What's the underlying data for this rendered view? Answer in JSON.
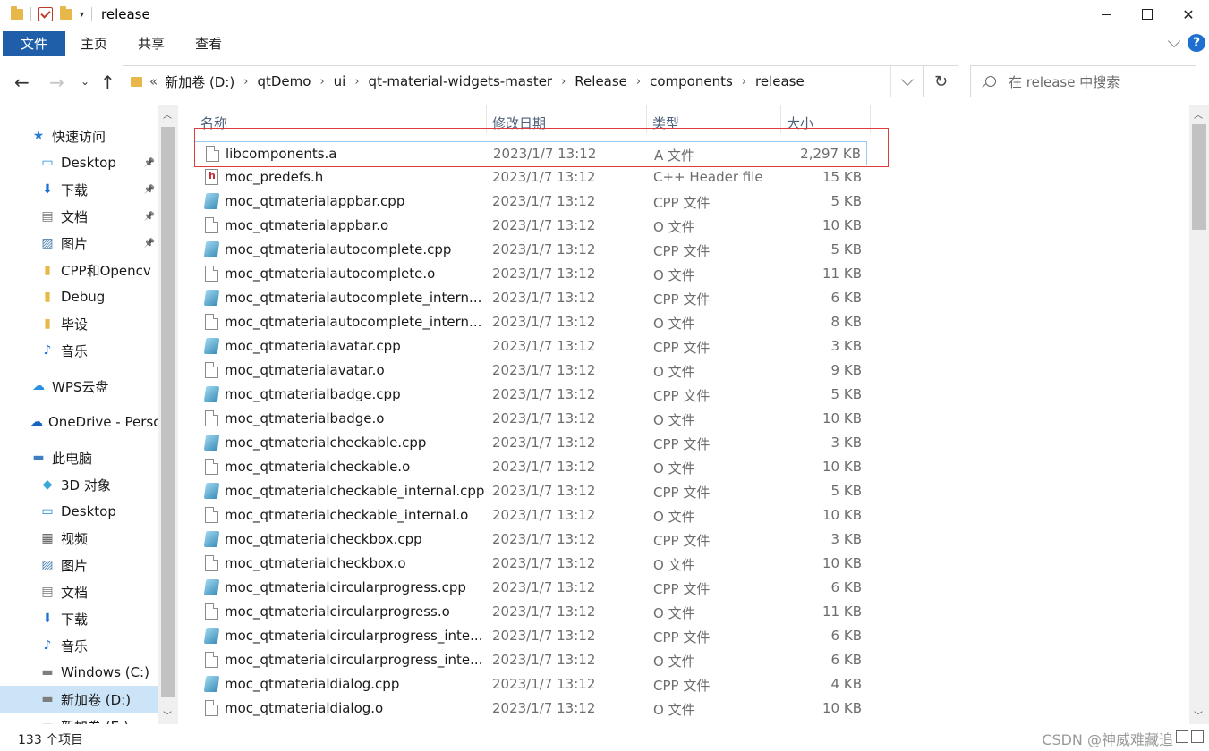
{
  "window": {
    "title": "release",
    "controls": {
      "minimize": "minimize",
      "maximize": "maximize",
      "close": "✕"
    }
  },
  "ribbon": {
    "tabs": [
      "文件",
      "主页",
      "共享",
      "查看"
    ],
    "help": "?"
  },
  "address": {
    "crumbs": [
      "新加卷 (D:)",
      "qtDemo",
      "ui",
      "qt-material-widgets-master",
      "Release",
      "components",
      "release"
    ],
    "overflow": "«",
    "search_placeholder": "在 release 中搜索"
  },
  "sidebar": {
    "items": [
      {
        "label": "快速访问",
        "icon": "star-icon",
        "level": 0,
        "pinned": false
      },
      {
        "label": "Desktop",
        "icon": "desktop-icon",
        "level": 1,
        "pinned": true
      },
      {
        "label": "下载",
        "icon": "download-icon",
        "level": 1,
        "pinned": true
      },
      {
        "label": "文档",
        "icon": "document-icon",
        "level": 1,
        "pinned": true
      },
      {
        "label": "图片",
        "icon": "picture-icon",
        "level": 1,
        "pinned": true
      },
      {
        "label": "CPP和Opencv",
        "icon": "folder-icon",
        "level": 1,
        "pinned": false
      },
      {
        "label": "Debug",
        "icon": "folder-icon",
        "level": 1,
        "pinned": false
      },
      {
        "label": "毕设",
        "icon": "folder-icon",
        "level": 1,
        "pinned": false
      },
      {
        "label": "音乐",
        "icon": "music-icon",
        "level": 1,
        "pinned": false
      },
      {
        "label": "WPS云盘",
        "icon": "cloud-icon",
        "level": 0,
        "pinned": false
      },
      {
        "label": "OneDrive - Perso",
        "icon": "onedrive-icon",
        "level": 0,
        "pinned": false
      },
      {
        "label": "此电脑",
        "icon": "computer-icon",
        "level": 0,
        "pinned": false
      },
      {
        "label": "3D 对象",
        "icon": "cube-icon",
        "level": 1,
        "pinned": false
      },
      {
        "label": "Desktop",
        "icon": "desktop-icon",
        "level": 1,
        "pinned": false
      },
      {
        "label": "视频",
        "icon": "video-icon",
        "level": 1,
        "pinned": false
      },
      {
        "label": "图片",
        "icon": "picture-icon",
        "level": 1,
        "pinned": false
      },
      {
        "label": "文档",
        "icon": "document-icon",
        "level": 1,
        "pinned": false
      },
      {
        "label": "下载",
        "icon": "download-icon",
        "level": 1,
        "pinned": false
      },
      {
        "label": "音乐",
        "icon": "music-icon",
        "level": 1,
        "pinned": false
      },
      {
        "label": "Windows (C:)",
        "icon": "drive-icon",
        "level": 1,
        "pinned": false
      },
      {
        "label": "新加卷 (D:)",
        "icon": "drive-icon",
        "level": 1,
        "pinned": false,
        "selected": true
      },
      {
        "label": "新加卷 (E:)",
        "icon": "drive-icon",
        "level": 1,
        "pinned": false
      }
    ]
  },
  "columns": [
    "名称",
    "修改日期",
    "类型",
    "大小"
  ],
  "files": [
    {
      "name": "libcomponents.a",
      "date": "2023/1/7 13:12",
      "type": "A 文件",
      "size": "2,297 KB",
      "icon": "doc"
    },
    {
      "name": "moc_predefs.h",
      "date": "2023/1/7 13:12",
      "type": "C++ Header file",
      "size": "15 KB",
      "icon": "h"
    },
    {
      "name": "moc_qtmaterialappbar.cpp",
      "date": "2023/1/7 13:12",
      "type": "CPP 文件",
      "size": "5 KB",
      "icon": "cpp"
    },
    {
      "name": "moc_qtmaterialappbar.o",
      "date": "2023/1/7 13:12",
      "type": "O 文件",
      "size": "10 KB",
      "icon": "doc"
    },
    {
      "name": "moc_qtmaterialautocomplete.cpp",
      "date": "2023/1/7 13:12",
      "type": "CPP 文件",
      "size": "5 KB",
      "icon": "cpp"
    },
    {
      "name": "moc_qtmaterialautocomplete.o",
      "date": "2023/1/7 13:12",
      "type": "O 文件",
      "size": "11 KB",
      "icon": "doc"
    },
    {
      "name": "moc_qtmaterialautocomplete_intern...",
      "date": "2023/1/7 13:12",
      "type": "CPP 文件",
      "size": "6 KB",
      "icon": "cpp"
    },
    {
      "name": "moc_qtmaterialautocomplete_intern...",
      "date": "2023/1/7 13:12",
      "type": "O 文件",
      "size": "8 KB",
      "icon": "doc"
    },
    {
      "name": "moc_qtmaterialavatar.cpp",
      "date": "2023/1/7 13:12",
      "type": "CPP 文件",
      "size": "3 KB",
      "icon": "cpp"
    },
    {
      "name": "moc_qtmaterialavatar.o",
      "date": "2023/1/7 13:12",
      "type": "O 文件",
      "size": "9 KB",
      "icon": "doc"
    },
    {
      "name": "moc_qtmaterialbadge.cpp",
      "date": "2023/1/7 13:12",
      "type": "CPP 文件",
      "size": "5 KB",
      "icon": "cpp"
    },
    {
      "name": "moc_qtmaterialbadge.o",
      "date": "2023/1/7 13:12",
      "type": "O 文件",
      "size": "10 KB",
      "icon": "doc"
    },
    {
      "name": "moc_qtmaterialcheckable.cpp",
      "date": "2023/1/7 13:12",
      "type": "CPP 文件",
      "size": "3 KB",
      "icon": "cpp"
    },
    {
      "name": "moc_qtmaterialcheckable.o",
      "date": "2023/1/7 13:12",
      "type": "O 文件",
      "size": "10 KB",
      "icon": "doc"
    },
    {
      "name": "moc_qtmaterialcheckable_internal.cpp",
      "date": "2023/1/7 13:12",
      "type": "CPP 文件",
      "size": "5 KB",
      "icon": "cpp"
    },
    {
      "name": "moc_qtmaterialcheckable_internal.o",
      "date": "2023/1/7 13:12",
      "type": "O 文件",
      "size": "10 KB",
      "icon": "doc"
    },
    {
      "name": "moc_qtmaterialcheckbox.cpp",
      "date": "2023/1/7 13:12",
      "type": "CPP 文件",
      "size": "3 KB",
      "icon": "cpp"
    },
    {
      "name": "moc_qtmaterialcheckbox.o",
      "date": "2023/1/7 13:12",
      "type": "O 文件",
      "size": "10 KB",
      "icon": "doc"
    },
    {
      "name": "moc_qtmaterialcircularprogress.cpp",
      "date": "2023/1/7 13:12",
      "type": "CPP 文件",
      "size": "6 KB",
      "icon": "cpp"
    },
    {
      "name": "moc_qtmaterialcircularprogress.o",
      "date": "2023/1/7 13:12",
      "type": "O 文件",
      "size": "11 KB",
      "icon": "doc"
    },
    {
      "name": "moc_qtmaterialcircularprogress_inte...",
      "date": "2023/1/7 13:12",
      "type": "CPP 文件",
      "size": "6 KB",
      "icon": "cpp"
    },
    {
      "name": "moc_qtmaterialcircularprogress_inte...",
      "date": "2023/1/7 13:12",
      "type": "O 文件",
      "size": "6 KB",
      "icon": "doc"
    },
    {
      "name": "moc_qtmaterialdialog.cpp",
      "date": "2023/1/7 13:12",
      "type": "CPP 文件",
      "size": "4 KB",
      "icon": "cpp"
    },
    {
      "name": "moc_qtmaterialdialog.o",
      "date": "2023/1/7 13:12",
      "type": "O 文件",
      "size": "10 KB",
      "icon": "doc"
    }
  ],
  "status": {
    "count": "133 个项目",
    "watermark": "CSDN @神威难藏追"
  },
  "colors": {
    "file_tab": "#1f5fa9",
    "selected_nav": "#cce4f7",
    "highlight_box": "#e03b3b"
  }
}
